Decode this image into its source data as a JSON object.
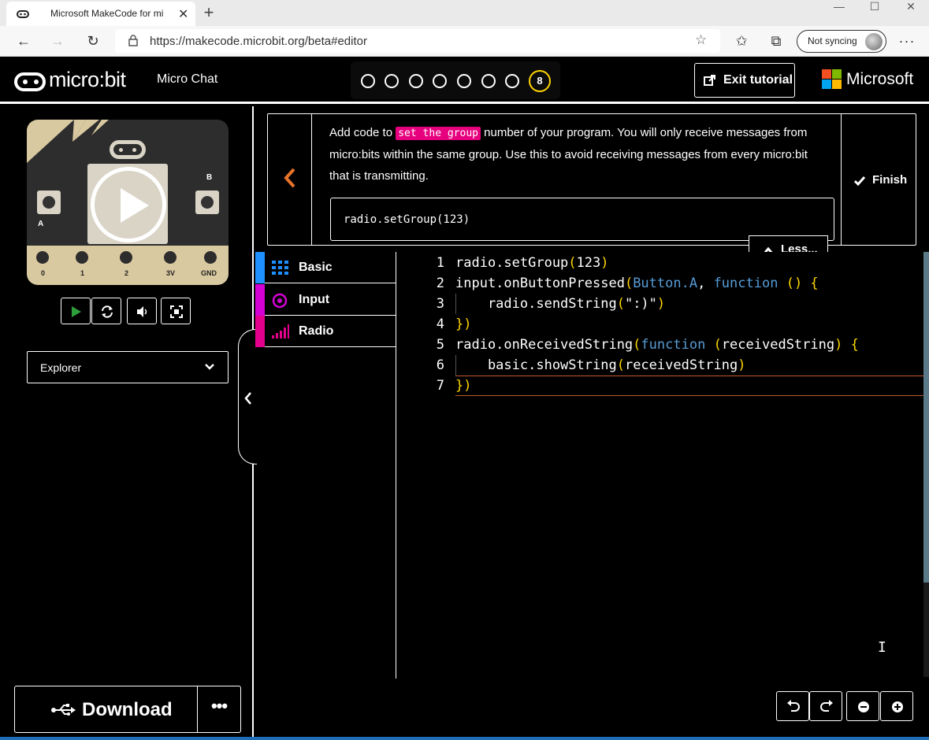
{
  "browser": {
    "tab_title": "Microsoft MakeCode for mi",
    "url": "https://makecode.microbit.org/beta#editor",
    "sync_label": "Not syncing"
  },
  "app": {
    "logo_text": "micro:bit",
    "project_name": "Micro Chat",
    "steps_total": 8,
    "current_step": "8",
    "exit_label": "Exit tutorial",
    "brand": "Microsoft"
  },
  "tutorial": {
    "text_before": "Add code to ",
    "highlight": "set the group",
    "text_after": " number of your program. You will only receive messages from micro:bits within the same group. Use this to avoid receiving messages from every micro:bit that is transmitting.",
    "code": "radio.setGroup(123)",
    "finish_label": "Finish",
    "less_label": "Less..."
  },
  "simulator": {
    "pins": [
      "0",
      "1",
      "2",
      "3V",
      "GND"
    ],
    "button_a": "A",
    "button_b": "B",
    "explorer_label": "Explorer"
  },
  "toolbox": {
    "categories": [
      {
        "label": "Basic",
        "color": "#1e90ff"
      },
      {
        "label": "Input",
        "color": "#d400d4"
      },
      {
        "label": "Radio",
        "color": "#e3008c"
      }
    ]
  },
  "editor": {
    "line_numbers": [
      "1",
      "2",
      "3",
      "4",
      "5",
      "6",
      "7"
    ]
  },
  "footer": {
    "download_label": "Download",
    "more_label": "•••"
  },
  "colors": {
    "accent_yellow": "#ffd400",
    "highlight_pink": "#e6007e",
    "back_arrow": "#e8732a"
  }
}
